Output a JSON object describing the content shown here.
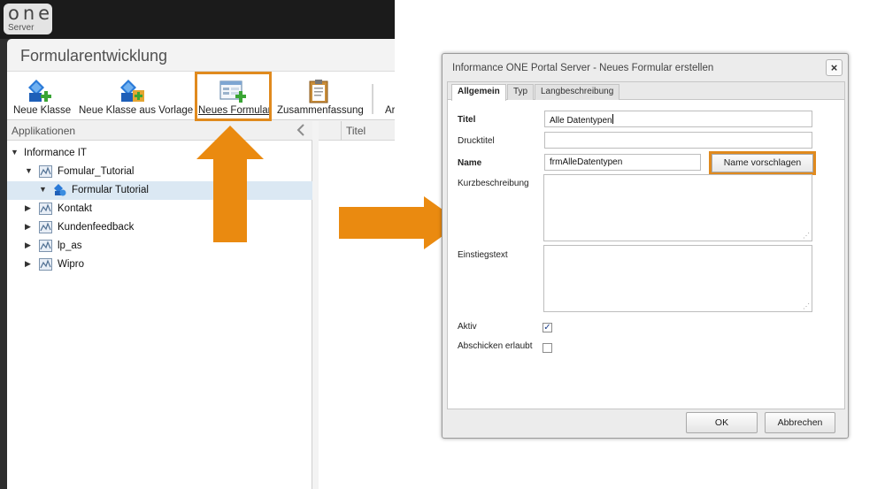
{
  "logo": {
    "line1": "one",
    "line2": "Server"
  },
  "window": {
    "title": "Formularentwicklung"
  },
  "toolbar": {
    "items": [
      {
        "label": "Neue Klasse",
        "icon": "new-class-icon"
      },
      {
        "label": "Neue Klasse aus Vorlage",
        "icon": "class-from-template-icon"
      },
      {
        "label": "Neues Formular",
        "icon": "new-form-icon"
      },
      {
        "label": "Zusammenfassung",
        "icon": "summary-clipboard-icon"
      },
      {
        "label": "Ar"
      }
    ]
  },
  "applications": {
    "header": "Applikationen",
    "tree": [
      {
        "label": "Informance IT",
        "expanded": true
      },
      {
        "label": "Fomular_Tutorial",
        "expanded": true
      },
      {
        "label": "Formular Tutorial",
        "expanded": true,
        "selected": true
      },
      {
        "label": "Kontakt",
        "expanded": false
      },
      {
        "label": "Kundenfeedback",
        "expanded": false
      },
      {
        "label": "lp_as",
        "expanded": false
      },
      {
        "label": "Wipro",
        "expanded": false
      }
    ]
  },
  "grid": {
    "column_title": "Titel"
  },
  "dialog": {
    "title": "Informance ONE Portal Server - Neues Formular erstellen",
    "close_label": "×",
    "tabs": [
      {
        "label": "Allgemein",
        "active": true
      },
      {
        "label": "Typ",
        "active": false
      },
      {
        "label": "Langbeschreibung",
        "active": false
      }
    ],
    "fields": {
      "titel": {
        "label": "Titel",
        "value": "Alle Datentypen"
      },
      "drucktitel": {
        "label": "Drucktitel",
        "value": ""
      },
      "name": {
        "label": "Name",
        "value": "frmAlleDatentypen"
      },
      "kurzbeschreibung": {
        "label": "Kurzbeschreibung",
        "value": ""
      },
      "einstiegstext": {
        "label": "Einstiegstext",
        "value": ""
      },
      "aktiv": {
        "label": "Aktiv",
        "checked": true
      },
      "abschicken": {
        "label": "Abschicken erlaubt",
        "checked": false
      }
    },
    "name_button": "Name vorschlagen",
    "ok_button": "OK",
    "cancel_button": "Abbrechen"
  },
  "colors": {
    "highlight": "#e08a1e",
    "arrow": "#ea8a10",
    "selection": "#dbe8f3",
    "app_background": "#2e2e2e"
  }
}
